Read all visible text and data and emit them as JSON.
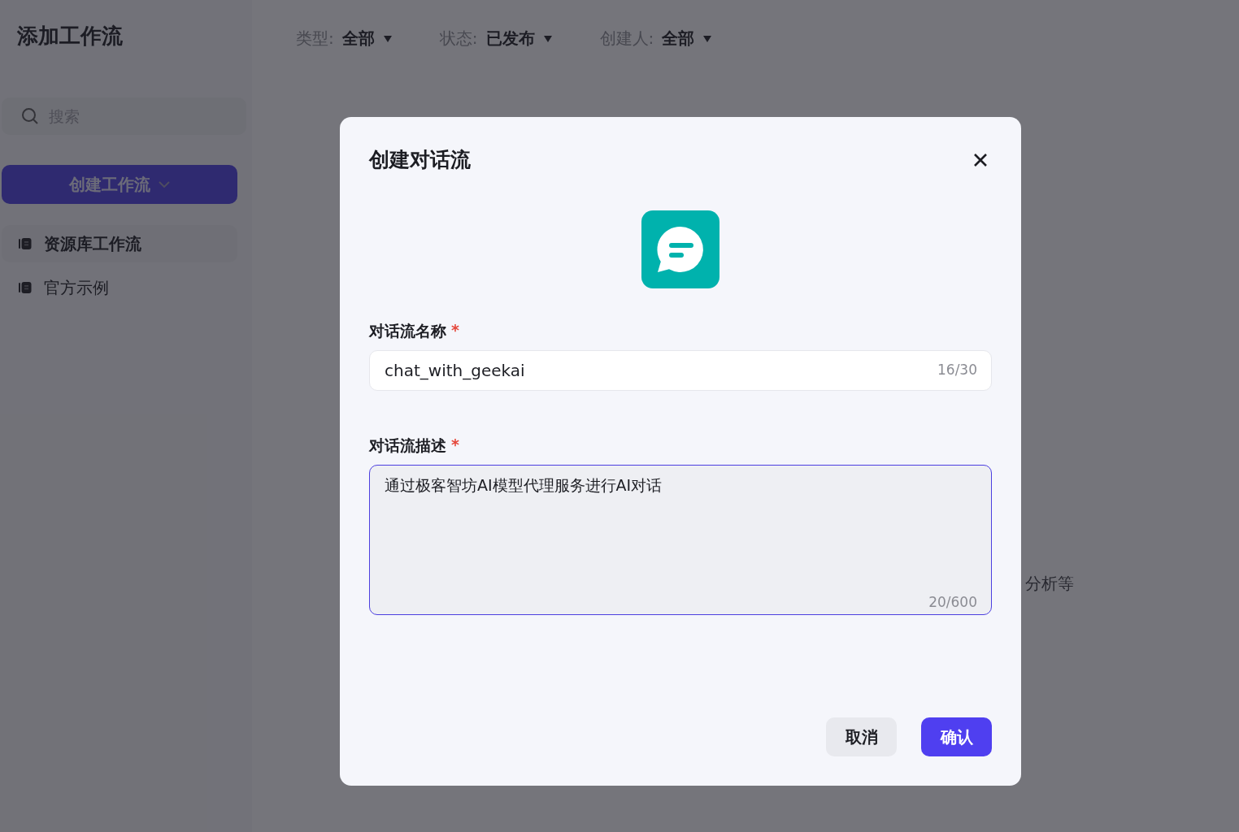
{
  "sidebar": {
    "title": "添加工作流",
    "search": {
      "placeholder": "搜索"
    },
    "create_button": "创建工作流",
    "items": [
      {
        "label": "资源库工作流",
        "selected": true
      },
      {
        "label": "官方示例",
        "selected": false
      }
    ]
  },
  "filters": [
    {
      "label": "类型:",
      "value": "全部"
    },
    {
      "label": "状态:",
      "value": "已发布"
    },
    {
      "label": "创建人:",
      "value": "全部"
    }
  ],
  "background_text": "分析等",
  "dialog": {
    "title": "创建对话流",
    "fields": [
      {
        "kind": "input",
        "label": "对话流名称",
        "required_mark": "*",
        "value": "chat_with_geekai",
        "counter": "16/30",
        "focused": false
      },
      {
        "kind": "textarea",
        "label": "对话流描述",
        "required_mark": "*",
        "value": "通过极客智坊AI模型代理服务进行AI对话",
        "counter": "20/600",
        "focused": true
      }
    ],
    "buttons": [
      {
        "label": "取消",
        "kind": "secondary"
      },
      {
        "label": "确认",
        "kind": "primary"
      }
    ]
  }
}
